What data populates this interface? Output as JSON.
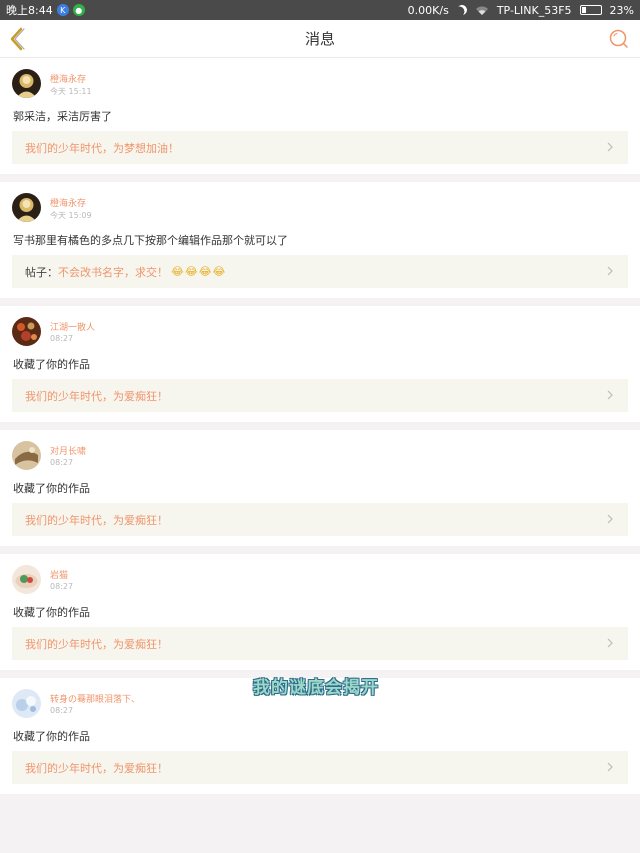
{
  "status_bar": {
    "time": "晚上8:44",
    "network_speed": "0.00K/s",
    "wifi_name": "TP-LINK_53F5",
    "battery": "23%",
    "battery_level": 0.23,
    "icons": [
      "k-badge-icon",
      "green-badge-icon",
      "moon-icon",
      "wifi-icon",
      "battery-icon"
    ]
  },
  "header": {
    "title": "消息",
    "back_icon": "chevron-left-icon",
    "search_icon": "search-icon"
  },
  "messages": [
    {
      "user": "橙海永存",
      "time": "今天 15:11",
      "text": "郭采洁，采洁厉害了",
      "ref_prefix": "",
      "ref_text": "我们的少年时代，为梦想加油！",
      "ref_emojis": ""
    },
    {
      "user": "橙海永存",
      "time": "今天 15:09",
      "text": "写书那里有橘色的多点几下按那个编辑作品那个就可以了",
      "ref_prefix": "帖子：",
      "ref_text": "不会改书名字，求交！",
      "ref_emojis": "😂😂😂😂"
    },
    {
      "user": "江湖一散人",
      "time": "08:27",
      "text": "收藏了你的作品",
      "ref_prefix": "",
      "ref_text": "我们的少年时代，为爱痴狂！",
      "ref_emojis": ""
    },
    {
      "user": "对月长啸",
      "time": "08:27",
      "text": "收藏了你的作品",
      "ref_prefix": "",
      "ref_text": "我们的少年时代，为爱痴狂！",
      "ref_emojis": ""
    },
    {
      "user": "岩猫",
      "time": "08:27",
      "text": "收藏了你的作品",
      "ref_prefix": "",
      "ref_text": "我们的少年时代，为爱痴狂！",
      "ref_emojis": ""
    },
    {
      "user": "转身の蓦那眼泪落下、",
      "time": "08:27",
      "text": "收藏了你的作品",
      "ref_prefix": "",
      "ref_text": "我们的少年时代，为爱痴狂！",
      "ref_emojis": ""
    }
  ],
  "watermark": "我的谜底会揭开",
  "colors": {
    "accent": "#f0956b",
    "reference_bg": "#f6f5ee",
    "page_bg": "#f4f2f2"
  }
}
